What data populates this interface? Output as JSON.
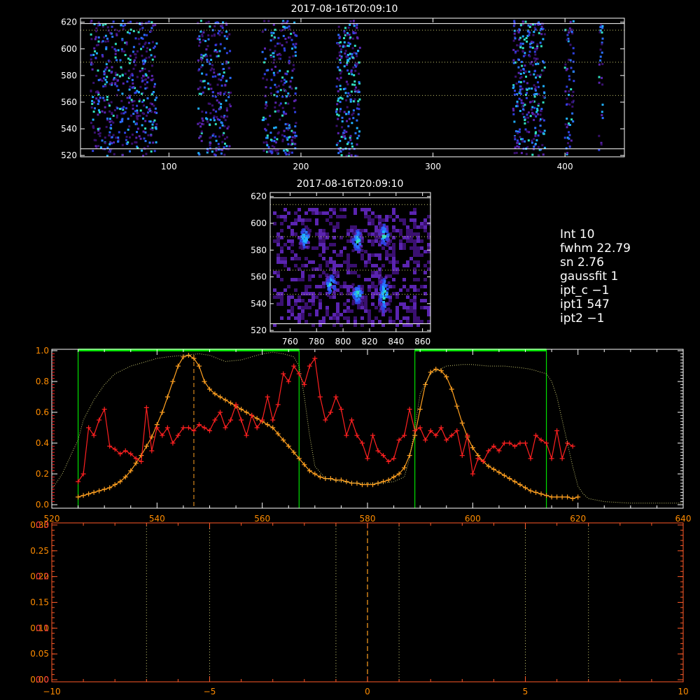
{
  "colors": {
    "background": "#000000",
    "frame": "#ffffff",
    "dotted_ref": "#c8c870",
    "green": "#00e000",
    "red_series": "#ff2020",
    "orange_series": "#ffa020",
    "spectrum_orange": "#ff8c00",
    "pixel_palette": [
      "#3a1070",
      "#5a24b0",
      "#3040e0",
      "#2a70ff",
      "#20b0ff",
      "#30e0c0"
    ]
  },
  "info_panel": {
    "lines": [
      "Int      10",
      "fwhm   22.79",
      "sn        2.76",
      "gaussfit  1",
      "ipt_c   −1",
      "ipt1  547",
      "ipt2   −1"
    ]
  },
  "chart_data": [
    {
      "id": "top-image",
      "type": "heatmap",
      "title": "2017-08-16T20:09:10",
      "xlim": [
        33,
        445
      ],
      "ylim": [
        519,
        623
      ],
      "xticks": [
        "100",
        "200",
        "300",
        "400"
      ],
      "yticks": [
        "520",
        "540",
        "560",
        "580",
        "600",
        "620"
      ],
      "solid_hlines": [
        525,
        619
      ],
      "dotted_hlines": [
        565,
        590,
        614
      ],
      "column_bands": [
        [
          40,
          90
        ],
        [
          121,
          146
        ],
        [
          170,
          196
        ],
        [
          226,
          244
        ],
        [
          360,
          384
        ],
        [
          399,
          406
        ],
        [
          425,
          428
        ]
      ]
    },
    {
      "id": "zoom-image",
      "type": "heatmap",
      "title": "2017-08-16T20:09:10",
      "xlim": [
        745,
        866
      ],
      "ylim": [
        519,
        623
      ],
      "xticks": [
        "760",
        "780",
        "800",
        "820",
        "840",
        "860"
      ],
      "yticks": [
        "520",
        "540",
        "560",
        "580",
        "600",
        "620"
      ],
      "solid_hlines": [
        525,
        619
      ],
      "dotted_hlines": [
        547,
        565,
        590,
        614
      ],
      "blobs": [
        [
          790,
          555
        ],
        [
          810,
          548
        ],
        [
          810,
          588
        ],
        [
          830,
          548
        ],
        [
          830,
          592
        ],
        [
          770,
          590
        ]
      ]
    },
    {
      "id": "profile-plot",
      "type": "line",
      "xlim": [
        520,
        640
      ],
      "ylim": [
        0,
        1
      ],
      "xticks": [
        "520",
        "540",
        "560",
        "580",
        "600",
        "620",
        "640"
      ],
      "yticks": [
        "0.0",
        "0.2",
        "0.4",
        "0.6",
        "0.8",
        "1.0"
      ],
      "green_windows": [
        [
          525,
          567
        ],
        [
          589,
          614
        ]
      ],
      "dashed_vline": 547,
      "series": [
        {
          "color": "orange",
          "x": [
            525,
            526,
            527,
            528,
            529,
            530,
            531,
            532,
            533,
            534,
            535,
            536,
            537,
            538,
            539,
            540,
            541,
            542,
            543,
            544,
            545,
            546,
            547,
            548,
            549,
            550,
            551,
            552,
            553,
            554,
            555,
            556,
            557,
            558,
            559,
            560,
            561,
            562,
            563,
            564,
            565,
            566,
            567,
            568,
            569,
            570,
            571,
            572,
            573,
            574,
            575,
            576,
            577,
            578,
            579,
            580,
            581,
            582,
            583,
            584,
            585,
            586,
            587,
            588,
            589,
            590,
            591,
            592,
            593,
            594,
            595,
            596,
            597,
            598,
            599,
            600,
            601,
            602,
            603,
            604,
            605,
            606,
            607,
            608,
            609,
            610,
            611,
            612,
            613,
            614,
            615,
            616,
            617,
            618,
            619,
            620
          ],
          "y": [
            0.05,
            0.06,
            0.07,
            0.08,
            0.09,
            0.1,
            0.11,
            0.13,
            0.15,
            0.18,
            0.22,
            0.27,
            0.32,
            0.38,
            0.44,
            0.52,
            0.6,
            0.7,
            0.8,
            0.9,
            0.96,
            0.97,
            0.95,
            0.9,
            0.8,
            0.75,
            0.72,
            0.7,
            0.68,
            0.66,
            0.64,
            0.62,
            0.6,
            0.58,
            0.56,
            0.54,
            0.52,
            0.5,
            0.46,
            0.42,
            0.38,
            0.34,
            0.3,
            0.26,
            0.22,
            0.2,
            0.18,
            0.17,
            0.17,
            0.16,
            0.16,
            0.15,
            0.14,
            0.14,
            0.13,
            0.13,
            0.13,
            0.14,
            0.15,
            0.16,
            0.18,
            0.2,
            0.24,
            0.32,
            0.45,
            0.62,
            0.78,
            0.86,
            0.88,
            0.87,
            0.83,
            0.75,
            0.64,
            0.53,
            0.44,
            0.37,
            0.32,
            0.28,
            0.25,
            0.23,
            0.21,
            0.19,
            0.17,
            0.15,
            0.13,
            0.11,
            0.09,
            0.08,
            0.07,
            0.06,
            0.05,
            0.05,
            0.05,
            0.05,
            0.04,
            0.05
          ]
        },
        {
          "color": "red",
          "x": [
            525,
            526,
            527,
            528,
            529,
            530,
            531,
            532,
            533,
            534,
            535,
            536,
            537,
            538,
            539,
            540,
            541,
            542,
            543,
            544,
            545,
            546,
            547,
            548,
            549,
            550,
            551,
            552,
            553,
            554,
            555,
            556,
            557,
            558,
            559,
            560,
            561,
            562,
            563,
            564,
            565,
            566,
            567,
            568,
            569,
            570,
            571,
            572,
            573,
            574,
            575,
            576,
            577,
            578,
            579,
            580,
            581,
            582,
            583,
            584,
            585,
            586,
            587,
            588,
            589,
            590,
            591,
            592,
            593,
            594,
            595,
            596,
            597,
            598,
            599,
            600,
            601,
            602,
            603,
            604,
            605,
            606,
            607,
            608,
            609,
            610,
            611,
            612,
            613,
            614,
            615,
            616,
            617,
            618,
            619
          ],
          "y": [
            0.15,
            0.2,
            0.5,
            0.45,
            0.55,
            0.62,
            0.38,
            0.36,
            0.33,
            0.35,
            0.33,
            0.3,
            0.28,
            0.63,
            0.35,
            0.5,
            0.45,
            0.5,
            0.4,
            0.45,
            0.5,
            0.5,
            0.48,
            0.52,
            0.5,
            0.48,
            0.55,
            0.6,
            0.5,
            0.55,
            0.65,
            0.55,
            0.45,
            0.58,
            0.5,
            0.55,
            0.7,
            0.55,
            0.65,
            0.85,
            0.8,
            0.9,
            0.85,
            0.78,
            0.9,
            0.95,
            0.7,
            0.55,
            0.6,
            0.7,
            0.62,
            0.45,
            0.55,
            0.45,
            0.4,
            0.3,
            0.45,
            0.35,
            0.32,
            0.28,
            0.3,
            0.42,
            0.45,
            0.62,
            0.48,
            0.5,
            0.42,
            0.48,
            0.45,
            0.5,
            0.42,
            0.45,
            0.48,
            0.32,
            0.45,
            0.2,
            0.3,
            0.28,
            0.35,
            0.38,
            0.35,
            0.4,
            0.4,
            0.38,
            0.4,
            0.4,
            0.3,
            0.45,
            0.42,
            0.4,
            0.3,
            0.48,
            0.3,
            0.4,
            0.38
          ]
        },
        {
          "color": "dotted",
          "x": [
            520,
            522,
            524,
            525,
            526,
            528,
            530,
            532,
            535,
            538,
            540,
            542,
            545,
            548,
            550,
            553,
            556,
            558,
            560,
            562,
            564,
            566,
            567,
            568,
            569,
            570,
            572,
            575,
            578,
            580,
            583,
            585,
            587,
            588,
            589,
            590,
            592,
            595,
            598,
            600,
            603,
            606,
            609,
            611,
            613,
            614,
            615,
            616,
            617,
            618,
            619,
            620,
            621,
            622,
            625,
            630,
            635,
            640
          ],
          "y": [
            0.1,
            0.2,
            0.35,
            0.42,
            0.55,
            0.68,
            0.78,
            0.85,
            0.9,
            0.93,
            0.95,
            0.96,
            0.97,
            0.98,
            0.97,
            0.93,
            0.94,
            0.96,
            0.98,
            0.99,
            0.98,
            0.96,
            0.9,
            0.7,
            0.45,
            0.25,
            0.17,
            0.15,
            0.14,
            0.14,
            0.14,
            0.15,
            0.18,
            0.3,
            0.5,
            0.72,
            0.85,
            0.9,
            0.91,
            0.91,
            0.9,
            0.9,
            0.89,
            0.88,
            0.86,
            0.85,
            0.8,
            0.7,
            0.55,
            0.4,
            0.25,
            0.12,
            0.07,
            0.04,
            0.02,
            0.01,
            0.01,
            0.01
          ]
        }
      ]
    },
    {
      "id": "bottom-plot",
      "type": "line",
      "xlim": [
        -10,
        10
      ],
      "ylim": [
        0,
        0.3
      ],
      "xticks": [
        "−10",
        "−5",
        "0",
        "5",
        "10"
      ],
      "xtick_values": [
        -10,
        -5,
        0,
        5,
        10
      ],
      "yticks_orange": [
        "0.00",
        "0.05",
        "0.10",
        "0.15",
        "0.20",
        "0.25",
        "0.30"
      ],
      "yticks_red": [
        "0.0",
        "0.1",
        "0.2",
        "0.3"
      ],
      "dotted_vlines": [
        -7,
        -5,
        -1,
        1,
        5,
        7
      ],
      "dashed_vline": 0
    }
  ]
}
